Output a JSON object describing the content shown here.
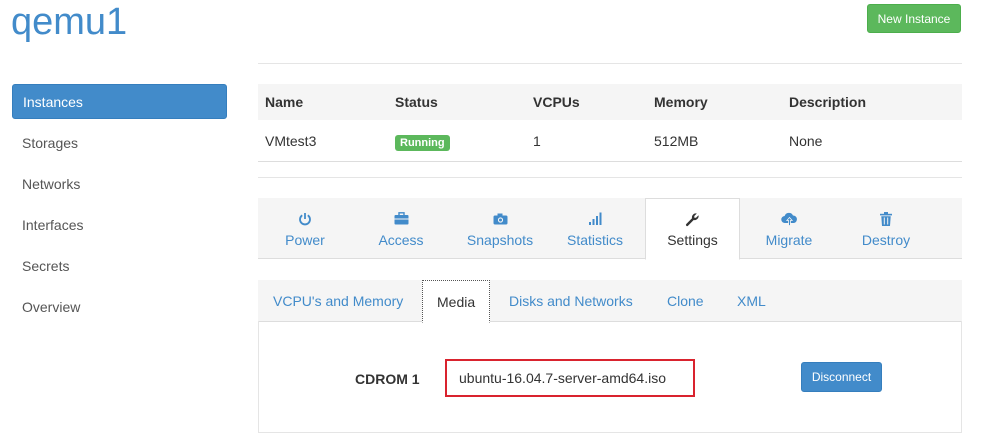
{
  "header": {
    "title": "qemu1",
    "new_instance_label": "New Instance"
  },
  "sidebar": {
    "items": [
      {
        "label": "Instances",
        "active": true
      },
      {
        "label": "Storages"
      },
      {
        "label": "Networks"
      },
      {
        "label": "Interfaces"
      },
      {
        "label": "Secrets"
      },
      {
        "label": "Overview"
      }
    ]
  },
  "table": {
    "columns": [
      "Name",
      "Status",
      "VCPUs",
      "Memory",
      "Description"
    ],
    "row": {
      "name": "VMtest3",
      "status": "Running",
      "vcpus": "1",
      "memory": "512MB",
      "description": "None"
    }
  },
  "tabs": [
    {
      "label": "Power",
      "icon": "power-icon"
    },
    {
      "label": "Access",
      "icon": "briefcase-icon"
    },
    {
      "label": "Snapshots",
      "icon": "camera-icon"
    },
    {
      "label": "Statistics",
      "icon": "signal-icon"
    },
    {
      "label": "Settings",
      "icon": "wrench-icon",
      "active": true
    },
    {
      "label": "Migrate",
      "icon": "cloud-upload-icon"
    },
    {
      "label": "Destroy",
      "icon": "trash-icon"
    }
  ],
  "subtabs": [
    {
      "label": "VCPU's and Memory"
    },
    {
      "label": "Media",
      "active": true
    },
    {
      "label": "Disks and Networks"
    },
    {
      "label": "Clone"
    },
    {
      "label": "XML"
    }
  ],
  "media": {
    "cdrom_label": "CDROM 1",
    "cdrom_value": "ubuntu-16.04.7-server-amd64.iso",
    "disconnect_label": "Disconnect"
  },
  "colors": {
    "primary": "#428bca",
    "success": "#5cb85c",
    "highlight": "#d9232e"
  }
}
